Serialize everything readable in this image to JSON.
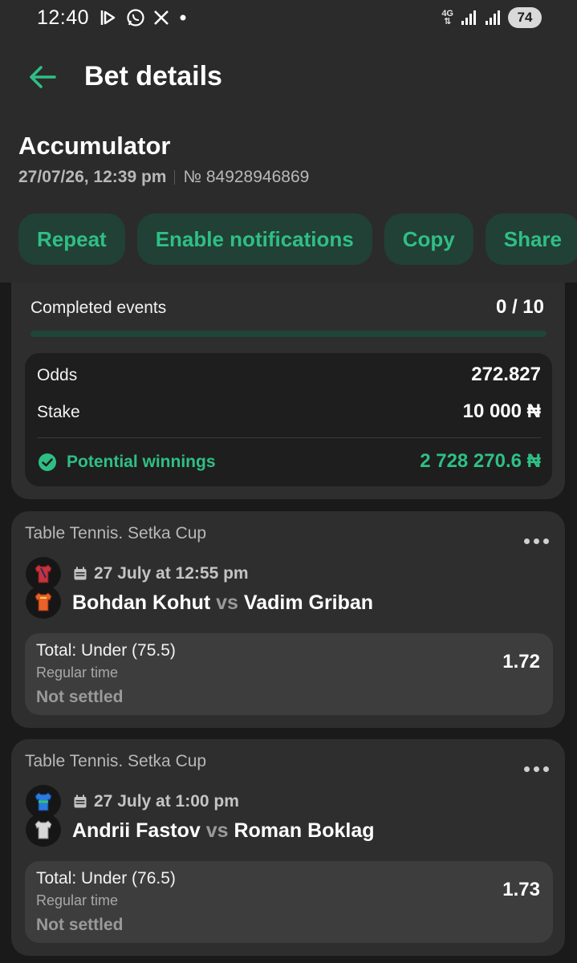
{
  "status_bar": {
    "time": "12:40",
    "network": "4G",
    "battery": "74"
  },
  "header": {
    "title": "Bet details"
  },
  "bet": {
    "type": "Accumulator",
    "datetime": "27/07/26, 12:39 pm",
    "number": "№ 84928946869"
  },
  "actions": [
    "Repeat",
    "Enable notifications",
    "Copy",
    "Share"
  ],
  "summary": {
    "completed_label": "Completed events",
    "completed_value": "0 / 10",
    "progress_fraction": 0,
    "odds_label": "Odds",
    "odds_value": "272.827",
    "stake_label": "Stake",
    "stake_value": "10 000 ₦",
    "winnings_label": "Potential winnings",
    "winnings_value": "2 728 270.6 ₦"
  },
  "events": [
    {
      "league": "Table Tennis. Setka Cup",
      "date": "27 July at 12:55 pm",
      "home": "Bohdan Kohut",
      "vs": "vs",
      "away": "Vadim Griban",
      "market": "Total: Under (75.5)",
      "period": "Regular time",
      "status": "Not settled",
      "odds": "1.72",
      "colors": {
        "home_jersey": "#c8323a",
        "away_jersey": "#e8622a"
      }
    },
    {
      "league": "Table Tennis. Setka Cup",
      "date": "27 July at 1:00 pm",
      "home": "Andrii Fastov",
      "vs": "vs",
      "away": "Roman Boklag",
      "market": "Total: Under (76.5)",
      "period": "Regular time",
      "status": "Not settled",
      "odds": "1.73",
      "colors": {
        "home_jersey": "#2a7be0",
        "away_jersey": "#d8d8d8"
      }
    }
  ],
  "colors": {
    "accent": "#2fbf85",
    "accent_bg": "#214036",
    "card_bg": "#2e2e2e",
    "page_bg": "#1a1a1a"
  }
}
